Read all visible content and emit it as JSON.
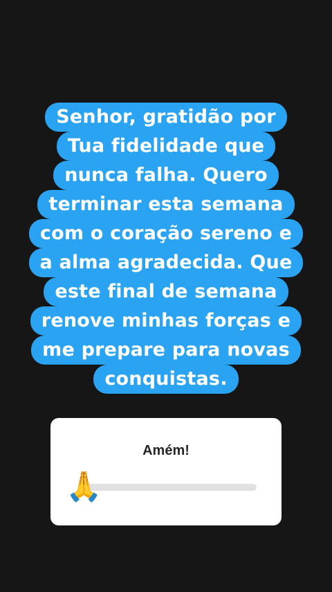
{
  "story": {
    "prayer_lines": [
      "Senhor, gratidão por",
      "Tua fidelidade que",
      "nunca falha. Quero",
      "terminar esta semana",
      "com o coração sereno e",
      "a alma agradecida. Que",
      "este final de semana",
      "renove minhas forças e",
      "me prepare para novas",
      "conquistas."
    ],
    "highlight_color": "#2aa3f2",
    "background_color": "#161616"
  },
  "slider_sticker": {
    "question": "Amém!",
    "emoji": "🙏",
    "emoji_name": "praying-hands-icon",
    "value": 0.0,
    "track_color": "#e1e1e1",
    "fill_color": "#f33c68"
  }
}
